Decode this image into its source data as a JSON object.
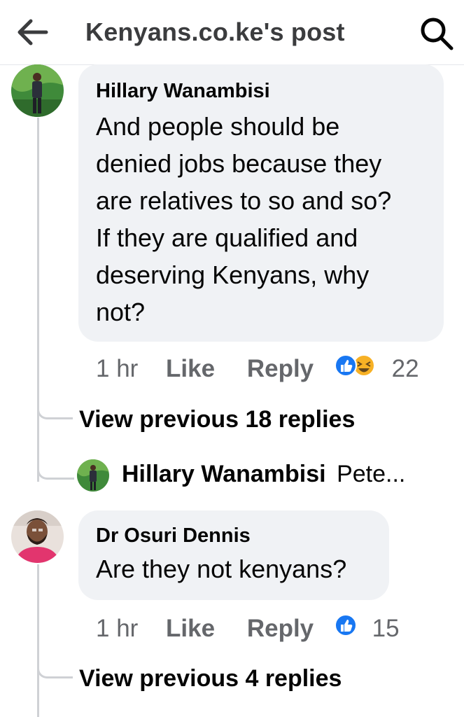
{
  "header": {
    "title": "Kenyans.co.ke's post",
    "back_icon": "back-arrow-icon",
    "search_icon": "search-icon"
  },
  "comments": [
    {
      "author": "Hillary Wanambisi",
      "text_lines": [
        "And people should be",
        "denied jobs because they",
        "are relatives to so and so?",
        "If they are qualified and",
        "deserving Kenyans, why",
        "not?"
      ],
      "time": "1 hr",
      "like_label": "Like",
      "reply_label": "Reply",
      "reaction_icons": [
        "like-reaction-icon",
        "haha-reaction-icon"
      ],
      "reaction_count": "22",
      "view_previous": "View previous 18 replies",
      "latest_reply": {
        "author": "Hillary Wanambisi",
        "preview": "Pete..."
      }
    },
    {
      "author": "Dr Osuri Dennis",
      "text_lines": [
        "Are they not kenyans?"
      ],
      "time": "1 hr",
      "like_label": "Like",
      "reply_label": "Reply",
      "reaction_icons": [
        "like-reaction-icon"
      ],
      "reaction_count": "15",
      "view_previous": "View previous 4 replies"
    }
  ],
  "colors": {
    "bubble": "#f0f2f5",
    "secondary_text": "#65676b",
    "like_blue": "#1877f2",
    "thread_line": "#cfd1d5"
  }
}
